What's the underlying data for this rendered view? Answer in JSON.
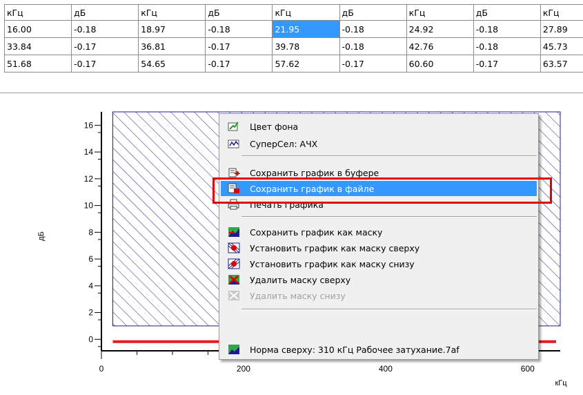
{
  "table": {
    "header": [
      "кГц",
      "дБ",
      "кГц",
      "дБ",
      "кГц",
      "дБ",
      "кГц",
      "дБ",
      "кГц"
    ],
    "rows": [
      [
        "16.00",
        "-0.18",
        "18.97",
        "-0.18",
        "21.95",
        "-0.18",
        "24.92",
        "-0.18",
        "27.89"
      ],
      [
        "33.84",
        "-0.17",
        "36.81",
        "-0.17",
        "39.78",
        "-0.18",
        "42.76",
        "-0.18",
        "45.73"
      ],
      [
        "51.68",
        "-0.17",
        "54.65",
        "-0.17",
        "57.62",
        "-0.17",
        "60.60",
        "-0.17",
        "63.57"
      ]
    ],
    "selected_cell": "21.95"
  },
  "chart_data": {
    "type": "line",
    "xlabel": "кГц",
    "ylabel": "дБ",
    "x_ticks": [
      "0",
      "200",
      "400",
      "600"
    ],
    "y_ticks": [
      "0",
      "2",
      "4",
      "6",
      "8",
      "10",
      "12",
      "14",
      "16"
    ],
    "xlim": [
      0,
      640
    ],
    "ylim": [
      -0.5,
      17
    ],
    "series": [
      {
        "color": "#e31b1b",
        "x": [
          16,
          640
        ],
        "y": [
          -0.18,
          -0.18
        ]
      }
    ],
    "mask_color": "#1c1c8c"
  },
  "menu": {
    "items": [
      {
        "label": "Цвет фона",
        "icon": "palette-icon"
      },
      {
        "label": "СуперСел: АЧХ",
        "icon": "chart-icon"
      },
      {
        "label": "Сохранить график в буфере",
        "icon": "clipboard-icon"
      },
      {
        "label": "Сохранить график в файле",
        "icon": "save-file-icon"
      },
      {
        "label": "Печать графика",
        "icon": "printer-icon"
      },
      {
        "label": "Сохранить график как маску",
        "icon": "save-mask-icon"
      },
      {
        "label": "Установить график как маску сверху",
        "icon": "mask-top-icon"
      },
      {
        "label": "Установить график как маску снизу",
        "icon": "mask-bottom-icon"
      },
      {
        "label": "Удалить маску сверху",
        "icon": "delete-mask-top-icon"
      },
      {
        "label": "Удалить маску снизу",
        "icon": "delete-mask-bottom-icon"
      },
      {
        "label": "Норма сверху: 310 кГц Рабочее затухание.7af",
        "icon": "norm-icon"
      }
    ],
    "highlighted": "Сохранить график в файле",
    "disabled": [
      "Удалить маску снизу"
    ]
  },
  "colors": {
    "selection": "#3399ff",
    "highlight_box": "#e30000"
  }
}
